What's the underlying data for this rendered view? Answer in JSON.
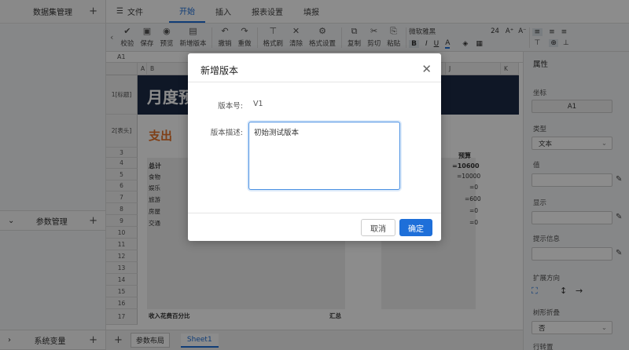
{
  "left_panel": {
    "dataset_title": "数据集管理",
    "param_title": "参数管理",
    "sysvar_title": "系统变量"
  },
  "topbar": {
    "file_label": "文件",
    "tabs": [
      "开始",
      "插入",
      "报表设置",
      "填报"
    ]
  },
  "toolbar": {
    "buttons": [
      {
        "icon": "check-icon",
        "glyph": "✔",
        "label": "校验"
      },
      {
        "icon": "save-icon",
        "glyph": "▣",
        "label": "保存"
      },
      {
        "icon": "eye-icon",
        "glyph": "◉",
        "label": "预览"
      },
      {
        "icon": "new-version-icon",
        "glyph": "▤",
        "label": "新增版本"
      },
      {
        "icon": "undo-icon",
        "glyph": "↶",
        "label": "撤销"
      },
      {
        "icon": "redo-icon",
        "glyph": "↷",
        "label": "重做"
      },
      {
        "icon": "format-brush-icon",
        "glyph": "⊤",
        "label": "格式刷"
      },
      {
        "icon": "clear-icon",
        "glyph": "✕",
        "label": "清除"
      },
      {
        "icon": "format-settings-icon",
        "glyph": "⚙",
        "label": "格式设置"
      },
      {
        "icon": "copy-icon",
        "glyph": "⧉",
        "label": "复制"
      },
      {
        "icon": "cut-icon",
        "glyph": "✂",
        "label": "剪切"
      },
      {
        "icon": "paste-icon",
        "glyph": "⎘",
        "label": "粘贴"
      }
    ],
    "font_name": "微软雅黑",
    "font_size": "24"
  },
  "sheet": {
    "cell_ref": "A1",
    "col_headers": [
      "A",
      "B",
      "J",
      "K"
    ],
    "rows": [
      "1[标题]",
      "2[表头]",
      "3",
      "4",
      "5",
      "6",
      "7",
      "8",
      "9",
      "10",
      "11",
      "12",
      "13",
      "14",
      "15",
      "16",
      "17"
    ],
    "title_text": "月度预",
    "header_text": "支出",
    "row4_label": "总计",
    "items": [
      "食物",
      "娱乐",
      "旅游",
      "房屋",
      "交通"
    ],
    "budget_header": "预算",
    "budget_total": "=10600",
    "budget_vals": [
      "=10000",
      "=0",
      "=600",
      "=0",
      "=0"
    ],
    "row17_left": "收入花费百分比",
    "row17_mid": "汇总"
  },
  "right_panel": {
    "title": "属性",
    "coord_label": "坐标",
    "coord_value": "A1",
    "type_label": "类型",
    "type_value": "文本",
    "value_label": "值",
    "display_label": "显示",
    "hint_label": "提示信息",
    "expand_label": "扩展方向",
    "fold_label": "树形折叠",
    "fold_value": "否",
    "extra_label": "行转置"
  },
  "bottom": {
    "layout_label": "参数布局",
    "sheet_tab": "Sheet1"
  },
  "dialog": {
    "title": "新增版本",
    "version_label": "版本号:",
    "version_value": "V1",
    "desc_label": "版本描述:",
    "desc_value": "初始测试版本",
    "cancel_label": "取消",
    "ok_label": "确定"
  },
  "colors": {
    "accent": "#1e6fd9",
    "title_bg": "#1d2b45",
    "header_text": "#e8742a"
  }
}
